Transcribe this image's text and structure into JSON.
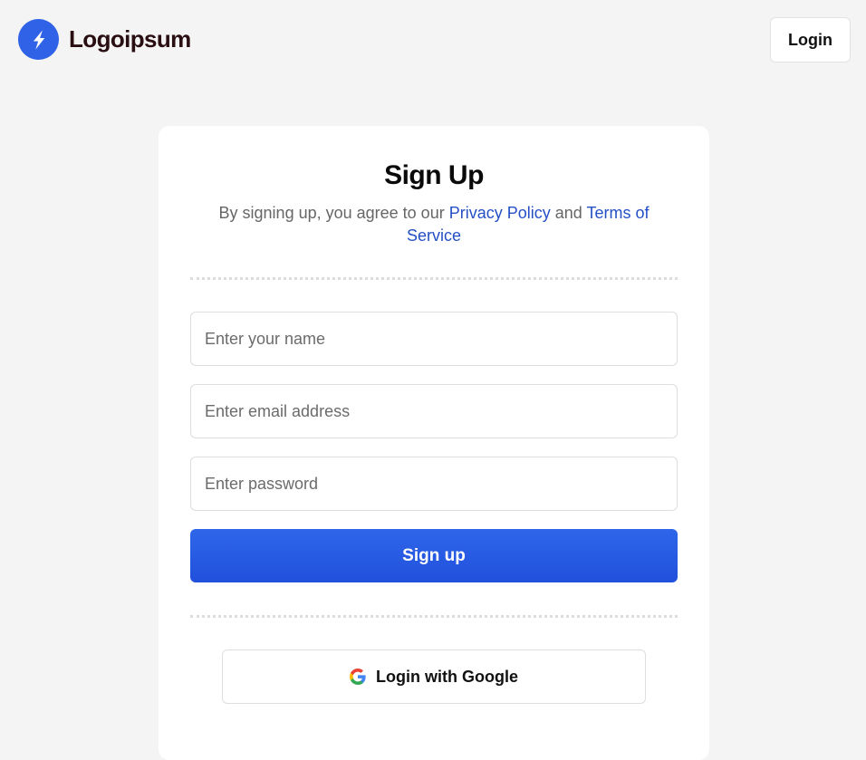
{
  "header": {
    "logo_text": "Logoipsum",
    "login_label": "Login"
  },
  "signup": {
    "title": "Sign Up",
    "terms_prefix": "By signing up, you agree to our ",
    "privacy_link": "Privacy Policy",
    "terms_and": " and ",
    "terms_link": "Terms of Service",
    "name_placeholder": "Enter your name",
    "email_placeholder": "Enter email address",
    "password_placeholder": "Enter password",
    "submit_label": "Sign up",
    "google_label": "Login with Google"
  },
  "icons": {
    "logo": "lightning-bolt-icon",
    "google": "google-icon"
  },
  "colors": {
    "brand": "#2f62e6",
    "primary_button": "#2559e3",
    "link": "#2450c4",
    "logo_text": "#2a0f12",
    "background": "#f4f4f4"
  }
}
